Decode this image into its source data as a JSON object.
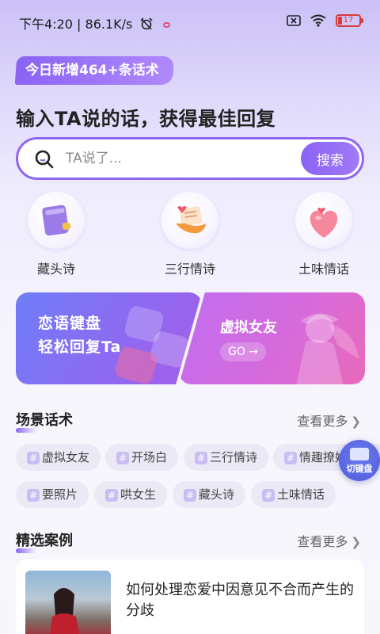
{
  "status_bar": {
    "time": "下午4:20",
    "network_speed": "86.1K/s",
    "battery": "17"
  },
  "badge": "今日新增464+条话术",
  "headline": "输入TA说的话，获得最佳回复",
  "search": {
    "placeholder": "TA说了...",
    "button_label": "搜索"
  },
  "categories": [
    {
      "label": "藏头诗",
      "icon": "notebook-icon"
    },
    {
      "label": "三行情诗",
      "icon": "love-letter-icon"
    },
    {
      "label": "土味情话",
      "icon": "heart-icon"
    }
  ],
  "banners": {
    "left": {
      "line1": "恋语键盘",
      "line2": "轻松回复Ta"
    },
    "right": {
      "title": "虚拟女友",
      "go": "GO →"
    }
  },
  "scene_section": {
    "title": "场景话术",
    "more": "查看更多",
    "tags": [
      "虚拟女友",
      "开场白",
      "三行情诗",
      "情趣撩妹",
      "要照片",
      "哄女生",
      "藏头诗",
      "土味情话"
    ]
  },
  "float_button": {
    "label": "切键盘"
  },
  "cases_section": {
    "title": "精选案例",
    "more": "查看更多",
    "items": [
      {
        "title": "如何处理恋爱中因意见不合而产生的分歧"
      }
    ]
  },
  "colors": {
    "accent": "#8a63f4",
    "battery_low": "#d93a3a"
  }
}
